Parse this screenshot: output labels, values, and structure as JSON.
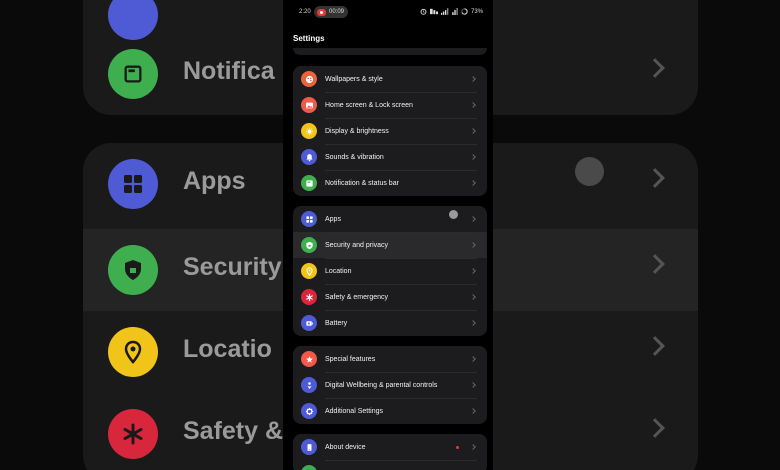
{
  "status_bar": {
    "time": "2:20",
    "recording": "00:09",
    "battery": "73%"
  },
  "header": {
    "title": "Settings"
  },
  "groups": [
    {
      "items": [
        {
          "label": "Wallpapers & style",
          "icon": "palette-icon",
          "color": "#e8643c"
        },
        {
          "label": "Home screen & Lock screen",
          "icon": "image-icon",
          "color": "#ef5a4a"
        },
        {
          "label": "Display & brightness",
          "icon": "sun-icon",
          "color": "#f0c419"
        },
        {
          "label": "Sounds & vibration",
          "icon": "bell-icon",
          "color": "#4f5bd5"
        },
        {
          "label": "Notification & status bar",
          "icon": "notification-icon",
          "color": "#3fae4e"
        }
      ]
    },
    {
      "items": [
        {
          "label": "Apps",
          "icon": "apps-grid-icon",
          "color": "#4f5bd5"
        },
        {
          "label": "Security and privacy",
          "icon": "shield-lock-icon",
          "color": "#3fae4e"
        },
        {
          "label": "Location",
          "icon": "location-pin-icon",
          "color": "#f0c419"
        },
        {
          "label": "Safety & emergency",
          "icon": "asterisk-icon",
          "color": "#d8263c"
        },
        {
          "label": "Battery",
          "icon": "battery-icon",
          "color": "#4f5bd5"
        }
      ]
    },
    {
      "items": [
        {
          "label": "Special features",
          "icon": "star-icon",
          "color": "#ef5a4a"
        },
        {
          "label": "Digital Wellbeing & parental controls",
          "icon": "wellbeing-icon",
          "color": "#4f5bd5"
        },
        {
          "label": "Additional Settings",
          "icon": "gear-icon",
          "color": "#4f5bd5"
        }
      ]
    },
    {
      "items": [
        {
          "label": "About device",
          "icon": "phone-icon",
          "color": "#4f5bd5"
        }
      ]
    }
  ],
  "background_zoom": {
    "labels": [
      "Notifica",
      "Apps",
      "Security",
      "Locatio",
      "Safety &"
    ]
  }
}
